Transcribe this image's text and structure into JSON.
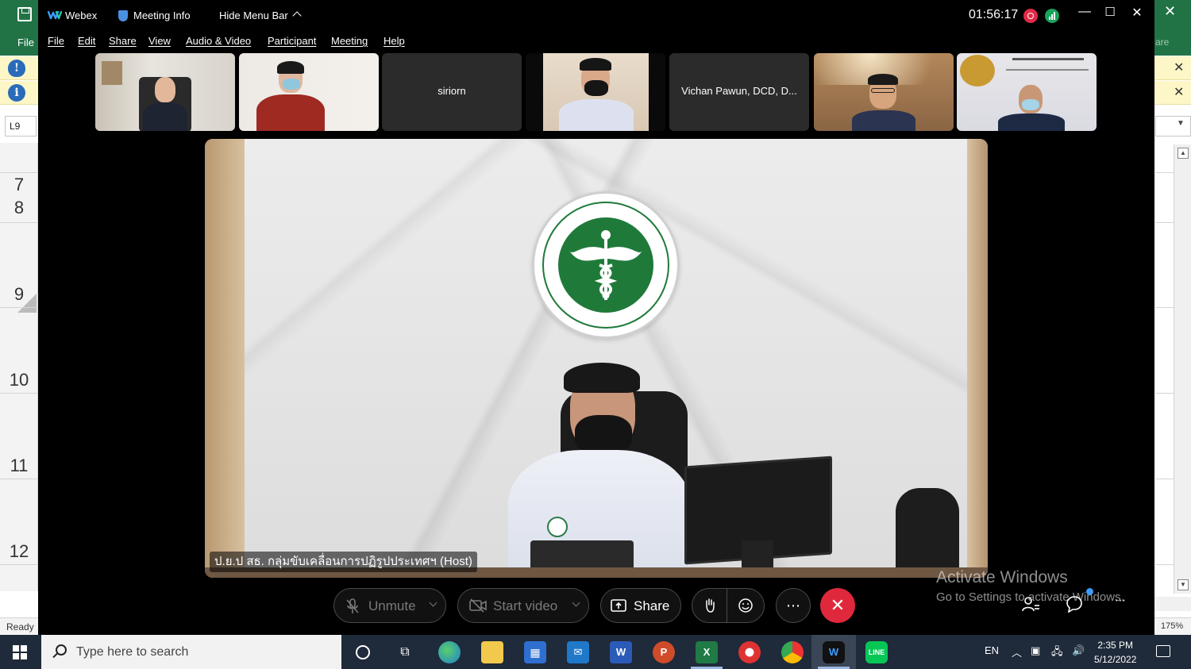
{
  "excel": {
    "file_label": "File",
    "namebox": "L9",
    "row_numbers": [
      "7",
      "8",
      "9",
      "10",
      "11",
      "12"
    ],
    "status_ready": "Ready",
    "zoom": "175%",
    "share_label": "are"
  },
  "webex": {
    "app_name": "Webex",
    "meeting_info": "Meeting Info",
    "hide_menu_bar": "Hide Menu Bar",
    "timer": "01:56:17",
    "menu": [
      "File",
      "Edit",
      "Share",
      "View",
      "Audio & Video",
      "Participant",
      "Meeting",
      "Help"
    ],
    "thumbnails": [
      {
        "name": "",
        "kind": "video"
      },
      {
        "name": "",
        "kind": "video"
      },
      {
        "name": "siriorn",
        "kind": "name"
      },
      {
        "name": "",
        "kind": "video"
      },
      {
        "name": "Vichan Pawun, DCD, D...",
        "kind": "name"
      },
      {
        "name": "",
        "kind": "video"
      },
      {
        "name": "",
        "kind": "video"
      }
    ],
    "active_speaker": "ป.ย.ป สธ. กลุ่มขับเคลื่อนการปฏิรูปประเทศฯ (Host)",
    "controls": {
      "unmute": "Unmute",
      "start_video": "Start video",
      "share": "Share"
    },
    "watermark_title": "Activate Windows",
    "watermark_sub": "Go to Settings to activate Windows."
  },
  "taskbar": {
    "search_placeholder": "Type here to search",
    "language": "EN",
    "time": "2:35 PM",
    "date": "5/12/2022"
  },
  "colors": {
    "excel_green": "#217346",
    "webex_black": "#000000",
    "end_call_red": "#e0283c",
    "record_red": "#e02b47",
    "moph_green": "#1f7a3a"
  }
}
